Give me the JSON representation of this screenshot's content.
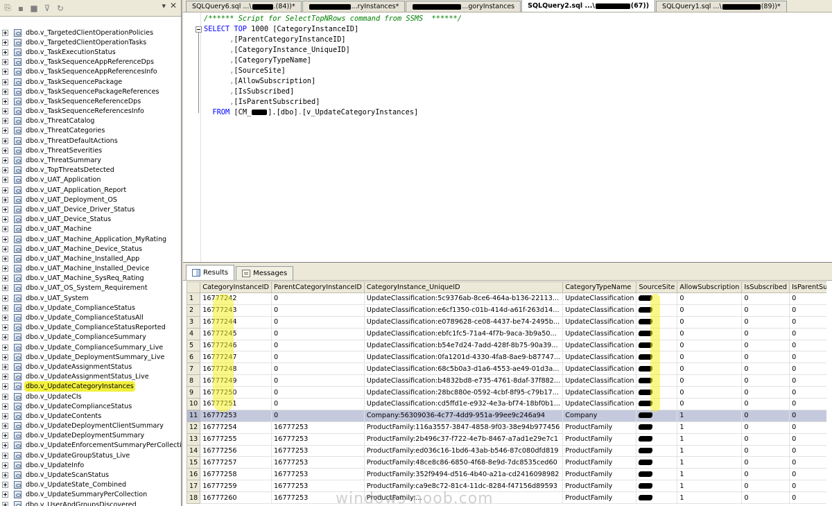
{
  "explorer": {
    "items": [
      "dbo.v_TargetedClientOperationPolicies",
      "dbo.v_TargetedClientOperationTasks",
      "dbo.v_TaskExecutionStatus",
      "dbo.v_TaskSequenceAppReferenceDps",
      "dbo.v_TaskSequenceAppReferencesInfo",
      "dbo.v_TaskSequencePackage",
      "dbo.v_TaskSequencePackageReferences",
      "dbo.v_TaskSequenceReferenceDps",
      "dbo.v_TaskSequenceReferencesInfo",
      "dbo.v_ThreatCatalog",
      "dbo.v_ThreatCategories",
      "dbo.v_ThreatDefaultActions",
      "dbo.v_ThreatSeverities",
      "dbo.v_ThreatSummary",
      "dbo.v_TopThreatsDetected",
      "dbo.v_UAT_Application",
      "dbo.v_UAT_Application_Report",
      "dbo.v_UAT_Deployment_OS",
      "dbo.v_UAT_Device_Driver_Status",
      "dbo.v_UAT_Device_Status",
      "dbo.v_UAT_Machine",
      "dbo.v_UAT_Machine_Application_MyRating",
      "dbo.v_UAT_Machine_Device_Status",
      "dbo.v_UAT_Machine_Installed_App",
      "dbo.v_UAT_Machine_Installed_Device",
      "dbo.v_UAT_Machine_SysReq_Rating",
      "dbo.v_UAT_OS_System_Requirement",
      "dbo.v_UAT_System",
      "dbo.v_Update_ComplianceStatus",
      "dbo.v_Update_ComplianceStatusAll",
      "dbo.v_Update_ComplianceStatusReported",
      "dbo.v_Update_ComplianceSummary",
      "dbo.v_Update_ComplianceSummary_Live",
      "dbo.v_Update_DeploymentSummary_Live",
      "dbo.v_UpdateAssignmentStatus",
      "dbo.v_UpdateAssignmentStatus_Live",
      "dbo.v_UpdateCategoryInstances",
      "dbo.v_UpdateCIs",
      "dbo.v_UpdateComplianceStatus",
      "dbo.v_UpdateContents",
      "dbo.v_UpdateDeploymentClientSummary",
      "dbo.v_UpdateDeploymentSummary",
      "dbo.v_UpdateEnforcementSummaryPerCollection",
      "dbo.v_UpdateGroupStatus_Live",
      "dbo.v_UpdateInfo",
      "dbo.v_UpdateScanStatus",
      "dbo.v_UpdateState_Combined",
      "dbo.v_UpdateSummaryPerCollection",
      "dbo.v_UserAndGroupsDiscovered"
    ]
  },
  "tabs": {
    "t1": "SQLQuery6.sql ...\\",
    "t1b": ".(84))*",
    "t2": "...ryInstances*",
    "t3": "...goryInstances",
    "t4": "SQLQuery2.sql ...\\",
    "t4b": "(67))",
    "t5": "SQLQuery1.sql ...\\",
    "t5b": "(89))*"
  },
  "code": {
    "comment": "/****** Script for SelectTopNRows command from SSMS  ******/",
    "select": "SELECT",
    "top": "TOP",
    "top_n": " 1000 ",
    "first_col": "[CategoryInstanceID]",
    "cols": [
      "[ParentCategoryInstanceID]",
      "[CategoryInstance_UniqueID]",
      "[CategoryTypeName]",
      "[SourceSite]",
      "[AllowSubscription]",
      "[IsSubscribed]",
      "[IsParentSubscribed]"
    ],
    "from": "FROM",
    "db": "[CM_",
    "db_end": "].",
    "schema": "[dbo]",
    "dot": ".",
    "view": "[v_UpdateCategoryInstances]"
  },
  "results": {
    "tab_results": "Results",
    "tab_messages": "Messages",
    "columns": [
      "CategoryInstanceID",
      "ParentCategoryInstanceID",
      "CategoryInstance_UniqueID",
      "CategoryTypeName",
      "SourceSite",
      "AllowSubscription",
      "IsSubscribed",
      "IsParentSubscribed"
    ],
    "rows": [
      [
        "1",
        "16777242",
        "0",
        "UpdateClassification:5c9376ab-8ce6-464a-b136-22113...",
        "UpdateClassification",
        "0",
        "0",
        "0"
      ],
      [
        "2",
        "16777243",
        "0",
        "UpdateClassification:e6cf1350-c01b-414d-a61f-263d14...",
        "UpdateClassification",
        "0",
        "0",
        "0"
      ],
      [
        "3",
        "16777244",
        "0",
        "UpdateClassification:e0789628-ce08-4437-be74-2495b...",
        "UpdateClassification",
        "0",
        "0",
        "0"
      ],
      [
        "4",
        "16777245",
        "0",
        "UpdateClassification:ebfc1fc5-71a4-4f7b-9aca-3b9a50...",
        "UpdateClassification",
        "0",
        "0",
        "0"
      ],
      [
        "5",
        "16777246",
        "0",
        "UpdateClassification:b54e7d24-7add-428f-8b75-90a39...",
        "UpdateClassification",
        "0",
        "0",
        "0"
      ],
      [
        "6",
        "16777247",
        "0",
        "UpdateClassification:0fa1201d-4330-4fa8-8ae9-b87747...",
        "UpdateClassification",
        "0",
        "0",
        "0"
      ],
      [
        "7",
        "16777248",
        "0",
        "UpdateClassification:68c5b0a3-d1a6-4553-ae49-01d3a...",
        "UpdateClassification",
        "0",
        "0",
        "0"
      ],
      [
        "8",
        "16777249",
        "0",
        "UpdateClassification:b4832bd8-e735-4761-8daf-37f882...",
        "UpdateClassification",
        "0",
        "0",
        "0"
      ],
      [
        "9",
        "16777250",
        "0",
        "UpdateClassification:28bc880e-0592-4cbf-8f95-c79b17...",
        "UpdateClassification",
        "0",
        "0",
        "0"
      ],
      [
        "10",
        "16777251",
        "0",
        "UpdateClassification:cd5ffd1e-e932-4e3a-bf74-18bf0b1...",
        "UpdateClassification",
        "0",
        "0",
        "0"
      ],
      [
        "11",
        "16777253",
        "0",
        "Company:56309036-4c77-4dd9-951a-99ee9c246a94",
        "Company",
        "1",
        "0",
        "0"
      ],
      [
        "12",
        "16777254",
        "16777253",
        "ProductFamily:116a3557-3847-4858-9f03-38e94b977456",
        "ProductFamily",
        "1",
        "0",
        "0"
      ],
      [
        "13",
        "16777255",
        "16777253",
        "ProductFamily:2b496c37-f722-4e7b-8467-a7ad1e29e7c1",
        "ProductFamily",
        "1",
        "0",
        "0"
      ],
      [
        "14",
        "16777256",
        "16777253",
        "ProductFamily:ed036c16-1bd6-43ab-b546-87c080dfd819",
        "ProductFamily",
        "1",
        "0",
        "0"
      ],
      [
        "15",
        "16777257",
        "16777253",
        "ProductFamily:48ce8c86-6850-4f68-8e9d-7dc8535ced60",
        "ProductFamily",
        "1",
        "0",
        "0"
      ],
      [
        "16",
        "16777258",
        "16777253",
        "ProductFamily:352f9494-d516-4b40-a21a-cd2416098982",
        "ProductFamily",
        "1",
        "0",
        "0"
      ],
      [
        "17",
        "16777259",
        "16777253",
        "ProductFamily:ca9e8c72-81c4-11dc-8284-f47156d89593",
        "ProductFamily",
        "1",
        "0",
        "0"
      ],
      [
        "18",
        "16777260",
        "16777253",
        "ProductFamily:...",
        "ProductFamily",
        "1",
        "0",
        "0"
      ]
    ]
  },
  "watermark": "windows-noob.com",
  "colors": {
    "highlight": "#f5f03a",
    "selected_row": "#c5c9dd",
    "keyword": "#0000ff",
    "comment": "#008000"
  }
}
